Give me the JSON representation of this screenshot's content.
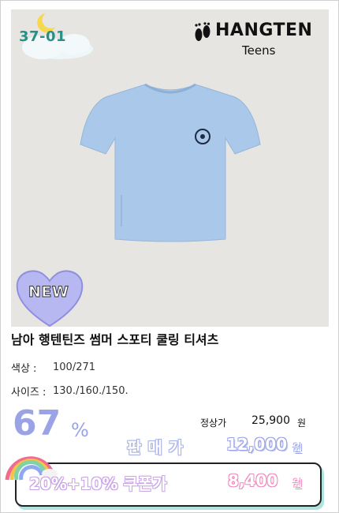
{
  "product": {
    "code": "37-01",
    "brand_name": "HANGTEN",
    "brand_sub": "Teens",
    "badge": "NEW",
    "title": "남아 행텐틴즈 썸머 스포티 쿨링 티셔츠",
    "color_label": "색상 :",
    "color_value": "100/271",
    "size_label": "사이즈 :",
    "size_value": "130./160./150."
  },
  "pricing": {
    "discount": "67",
    "discount_unit": "%",
    "regular_label": "정상가",
    "regular_price": "25,900",
    "regular_unit": "원",
    "sale_label": "판매가",
    "sale_price": "12,000",
    "sale_unit": "원",
    "coupon_label": "20%+10% 쿠폰가",
    "coupon_price": "8,400",
    "coupon_unit": "원"
  },
  "colors": {
    "photo_bg": "#e6e5e1",
    "shirt": "#a9c8ea",
    "accent_purple": "#9aa3e6",
    "accent_pink": "#f08bc0",
    "accent_teal": "#aee3de"
  },
  "icons": [
    "moon-icon",
    "cloud-icon",
    "footprints-icon",
    "heart-icon",
    "rainbow-icon"
  ]
}
